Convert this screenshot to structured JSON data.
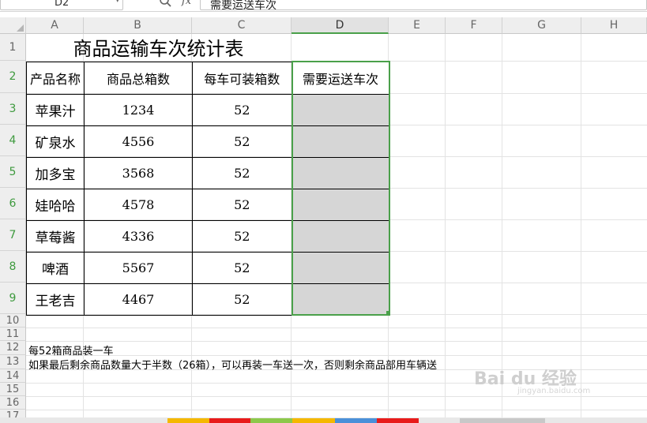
{
  "formula_bar": {
    "name_box": "D2",
    "fx_label": "fx",
    "formula": "需要运送车次"
  },
  "columns": [
    "A",
    "B",
    "C",
    "D",
    "E",
    "F",
    "G",
    "H"
  ],
  "rows": [
    "1",
    "2",
    "3",
    "4",
    "5",
    "6",
    "7",
    "8",
    "9",
    "10",
    "11",
    "12",
    "13",
    "14",
    "15",
    "16",
    "17"
  ],
  "sheet": {
    "title": "商品运输车次统计表",
    "headers": [
      "产品名称",
      "商品总箱数",
      "每车可装箱数",
      "需要运送车次"
    ],
    "data": [
      [
        "苹果汁",
        "1234",
        "52",
        ""
      ],
      [
        "矿泉水",
        "4556",
        "52",
        ""
      ],
      [
        "加多宝",
        "3568",
        "52",
        ""
      ],
      [
        "娃哈哈",
        "4578",
        "52",
        ""
      ],
      [
        "草莓酱",
        "4336",
        "52",
        ""
      ],
      [
        "啤酒",
        "5567",
        "52",
        ""
      ],
      [
        "王老吉",
        "4467",
        "52",
        ""
      ]
    ],
    "note1": "每52箱商品装一车",
    "note2": "如果最后剩余商品数量大于半数（26箱），可以再装一车送一次，否则剩余商品部用车辆送"
  },
  "watermark": {
    "logo": "Bai du 经验",
    "url": "jingyan.baidu.com"
  },
  "colors": {
    "selection": "#4aa04a",
    "selected_fill": "#d6d6d6"
  }
}
